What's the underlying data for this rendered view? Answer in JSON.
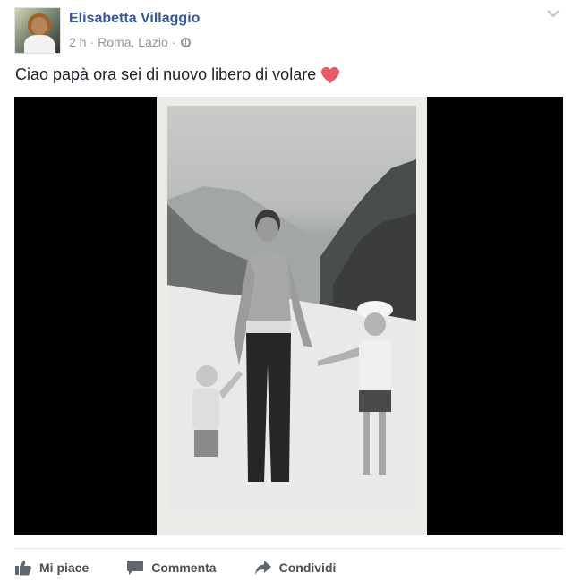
{
  "post": {
    "author": "Elisabetta Villaggio",
    "time": "2 h",
    "separator": "·",
    "location": "Roma, Lazio",
    "separator2": "·",
    "privacy_icon": "globe-icon",
    "text": "Ciao papà ora sei di nuovo libero di volare",
    "emoji": "heart-icon",
    "photo_description_icon": "photo"
  },
  "actions": [
    {
      "label": "Mi piace",
      "icon": "thumbs-up-icon"
    },
    {
      "label": "Commenta",
      "icon": "comment-icon"
    },
    {
      "label": "Condividi",
      "icon": "share-icon"
    }
  ],
  "colors": {
    "author": "#365899",
    "meta": "#90949c",
    "text": "#1d2129",
    "action_text": "#4b4f56",
    "heart": "#e65a6a"
  }
}
